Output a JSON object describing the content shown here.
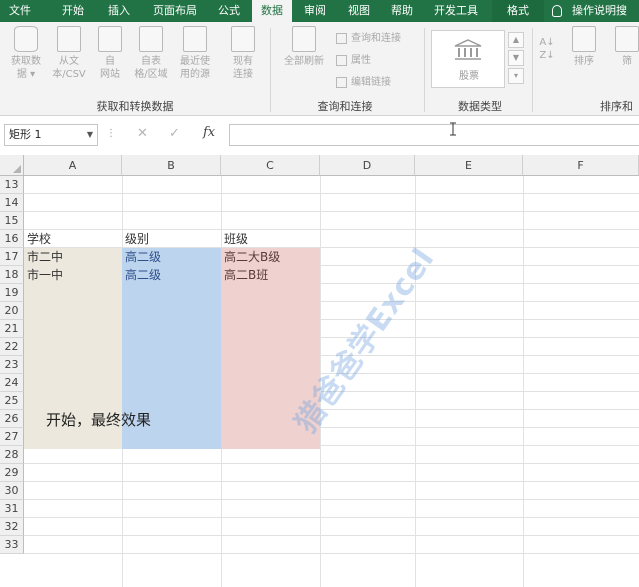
{
  "tabs": [
    {
      "label": "文件",
      "active": false
    },
    {
      "label": "开始",
      "active": false
    },
    {
      "label": "插入",
      "active": false
    },
    {
      "label": "页面布局",
      "active": false
    },
    {
      "label": "公式",
      "active": false
    },
    {
      "label": "数据",
      "active": true
    },
    {
      "label": "审阅",
      "active": false
    },
    {
      "label": "视图",
      "active": false
    },
    {
      "label": "帮助",
      "active": false
    },
    {
      "label": "开发工具",
      "active": false
    },
    {
      "label": "格式",
      "active": false
    }
  ],
  "help_search": "操作说明搜",
  "ribbon": {
    "get_data": {
      "buttons": [
        "获取数\n据 ▾",
        "从文\n本/CSV",
        "自\n网站",
        "自表\n格/区域",
        "最近使\n用的源",
        "现有\n连接"
      ],
      "group_label": "获取和转换数据"
    },
    "queries": {
      "refresh_all": "全部刷新",
      "small": [
        "查询和连接",
        "属性",
        "编辑链接"
      ],
      "group_label": "查询和连接"
    },
    "data_types": {
      "stock": "股票",
      "group_label": "数据类型"
    },
    "sort": {
      "sort_label": "排序",
      "filter_label": "筛",
      "group_label": "排序和"
    }
  },
  "formula_bar": {
    "name_box": "矩形 1",
    "fx": "fx",
    "formula": ""
  },
  "columns": [
    "A",
    "B",
    "C",
    "D",
    "E",
    "F"
  ],
  "rows": [
    "13",
    "14",
    "15",
    "16",
    "17",
    "18",
    "19",
    "20",
    "21",
    "22",
    "23",
    "24",
    "25",
    "26",
    "27",
    "28",
    "29",
    "30",
    "31",
    "32",
    "33"
  ],
  "cells": {
    "a16": "学校",
    "b16": "级别",
    "c16": "班级",
    "a17": "市二中",
    "b17": "高二级",
    "c17": "高二大B级",
    "a18": "市一中",
    "b18": "高二级",
    "c18": "高二B班"
  },
  "shape_text": "开始，最终效果",
  "watermark": "猎爸爸学Excel",
  "colors": {
    "brand_green": "#217346",
    "shape_beige": "#ece8dd",
    "shape_blue": "#bcd4ee",
    "shape_pink": "#efd2d0"
  }
}
